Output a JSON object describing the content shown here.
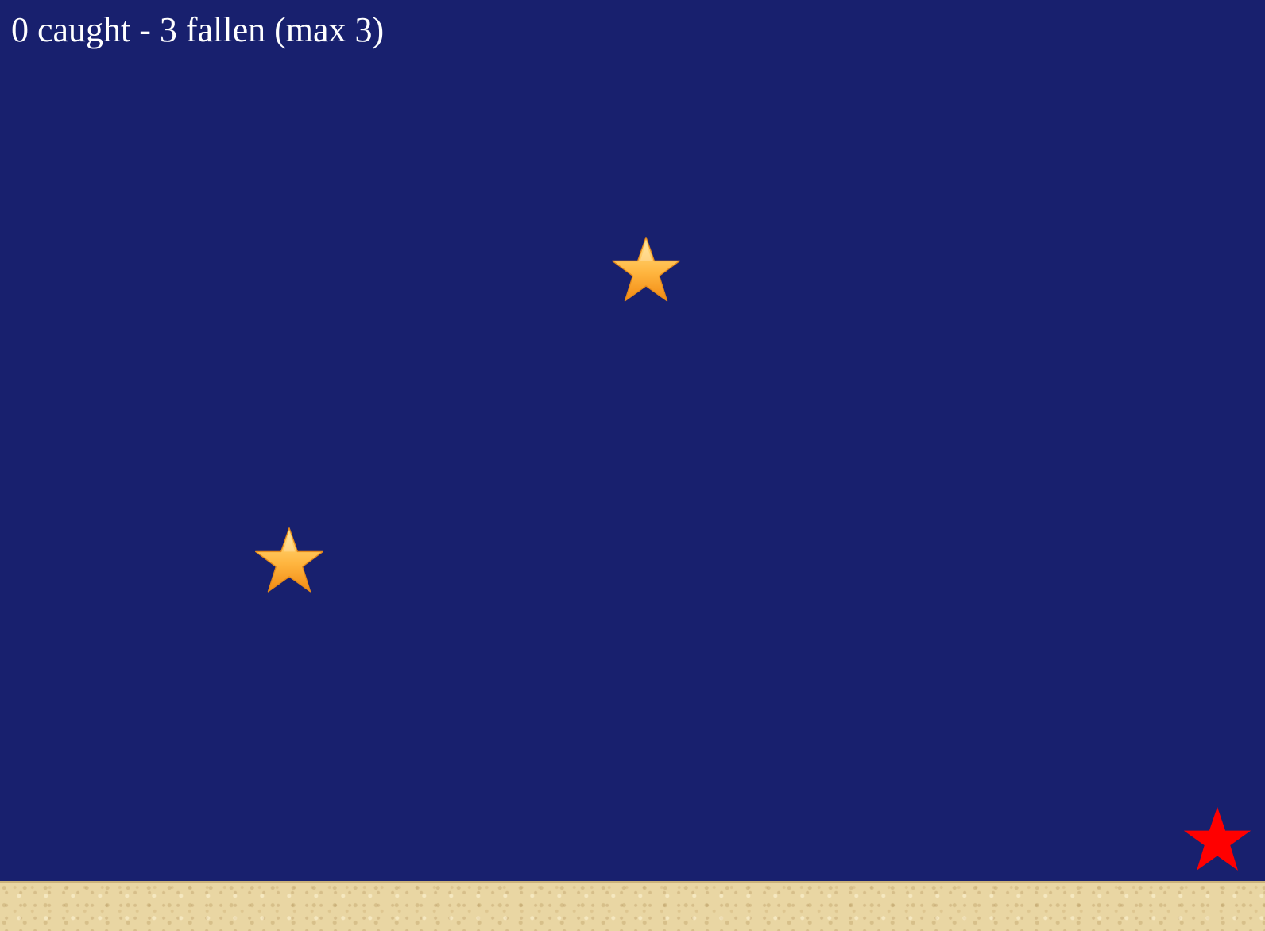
{
  "hud": {
    "status_text": "0 caught - 3 fallen (max 3)",
    "caught": 0,
    "fallen": 3,
    "max_fallen": 3
  },
  "falling_stars": [
    {
      "name": "falling-star-1",
      "icon": "gold-star-icon"
    },
    {
      "name": "falling-star-2",
      "icon": "gold-star-icon"
    }
  ],
  "player": {
    "icon": "red-star-icon",
    "color": "#ff0000"
  },
  "colors": {
    "sky": "#18206e",
    "ground": "#e9d6a3",
    "star_gold_light": "#ffd977",
    "star_gold_dark": "#f59a1c",
    "hud_text": "#ffffff"
  }
}
